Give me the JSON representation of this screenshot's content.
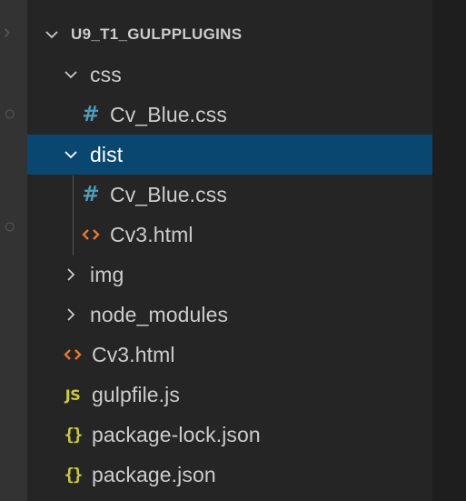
{
  "explorer": {
    "root": {
      "label": "U9_T1_GULPPLUGINS",
      "expanded": true
    },
    "items": [
      {
        "label": "css",
        "kind": "folder",
        "expanded": true,
        "depth": 1
      },
      {
        "label": "Cv_Blue.css",
        "kind": "css-file",
        "depth": 2
      },
      {
        "label": "dist",
        "kind": "folder",
        "expanded": true,
        "selected": true,
        "depth": 1
      },
      {
        "label": "Cv_Blue.css",
        "kind": "css-file",
        "depth": 2
      },
      {
        "label": "Cv3.html",
        "kind": "html-file",
        "depth": 2
      },
      {
        "label": "img",
        "kind": "folder",
        "expanded": false,
        "depth": 1
      },
      {
        "label": "node_modules",
        "kind": "folder",
        "expanded": false,
        "depth": 1
      },
      {
        "label": "Cv3.html",
        "kind": "html-file",
        "depth": 1
      },
      {
        "label": "gulpfile.js",
        "kind": "js-file",
        "depth": 1
      },
      {
        "label": "package-lock.json",
        "kind": "json-file",
        "depth": 1
      },
      {
        "label": "package.json",
        "kind": "json-file",
        "depth": 1
      }
    ]
  },
  "icons": {
    "css": {
      "name": "hash-icon",
      "glyph": "#",
      "color": "#519aba"
    },
    "html": {
      "name": "html-brackets-icon",
      "color": "#e37933"
    },
    "js": {
      "name": "js-icon",
      "glyph": "JS",
      "color": "#cbcb41"
    },
    "json": {
      "name": "json-braces-icon",
      "glyph": "{}",
      "color": "#cbcb41"
    }
  },
  "colors": {
    "sidebar_bg": "#252526",
    "selection_bg": "#094771",
    "text": "#cccccc",
    "activity_bar": "#333333",
    "editor_bg": "#1e1e1e"
  }
}
